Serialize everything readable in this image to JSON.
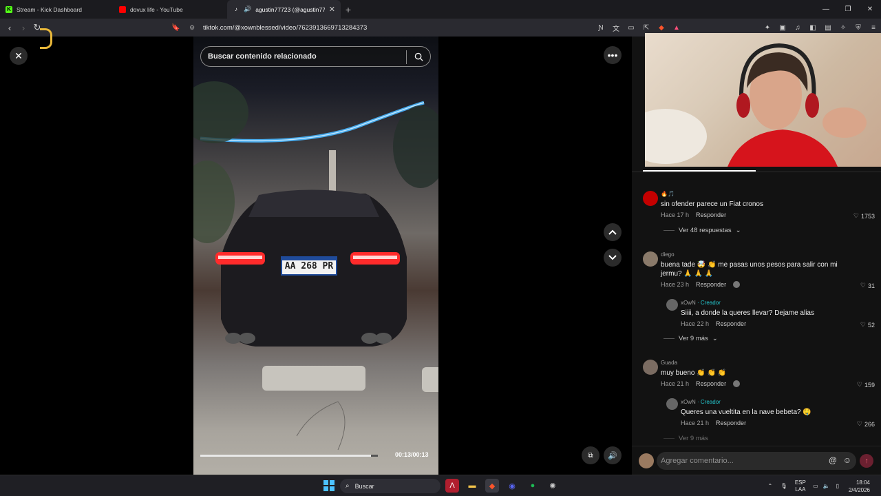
{
  "browser": {
    "tabs": [
      {
        "title": "Stream - Kick Dashboard",
        "favicon": "kick-icon",
        "active": false
      },
      {
        "title": "dovux life - YouTube",
        "favicon": "youtube-icon",
        "active": false
      },
      {
        "title": "agustin77723 (@agustin7772",
        "favicon": "tiktok-icon",
        "active": true
      }
    ],
    "url": "tiktok.com/@xownblessed/video/7623913669713284373"
  },
  "video": {
    "search_placeholder": "Buscar contenido relacionado",
    "plate_text": "AA 268 PR",
    "progress": 0.96,
    "timecode": "00:13/00:13"
  },
  "comments": [
    {
      "user": "🔥🎵",
      "text": "sin ofender parece un Fiat cronos",
      "time": "Hace 17 h",
      "reply": "Responder",
      "likes": "1753",
      "view_replies": "Ver 48 respuestas"
    },
    {
      "user": "diego",
      "text_line1": "buena tade 🤯 👏 me pasas unos pesos para salir con mi",
      "text_line2": "jermu? 🙏 🙏 🙏",
      "time": "Hace 23 h",
      "reply": "Responder",
      "likes": "31"
    },
    {
      "user": "xOwN",
      "creator": "· Creador",
      "text": "Siiii, a donde la queres llevar? Dejame alias",
      "time": "Hace 22 h",
      "reply": "Responder",
      "likes": "52",
      "view_more": "Ver 9 más"
    },
    {
      "user": "Guada",
      "text": "muy bueno 👏 👏 👏",
      "time": "Hace 21 h",
      "reply": "Responder",
      "likes": "159"
    },
    {
      "user": "xOwN",
      "creator": "· Creador",
      "text": "Queres una vueltita en la nave bebeta? 🤤",
      "time": "Hace 21 h",
      "reply": "Responder",
      "likes": "266",
      "view_more": "Ver 9 más"
    }
  ],
  "add_comment_placeholder": "Agregar comentario...",
  "taskbar": {
    "search": "Buscar",
    "lang_line1": "ESP",
    "lang_line2": "LAA",
    "time": "18:04",
    "date": "2/4/2026"
  },
  "colors": {
    "accent": "#fe2c55",
    "creator": "#25c9d0",
    "background": "#000000"
  }
}
